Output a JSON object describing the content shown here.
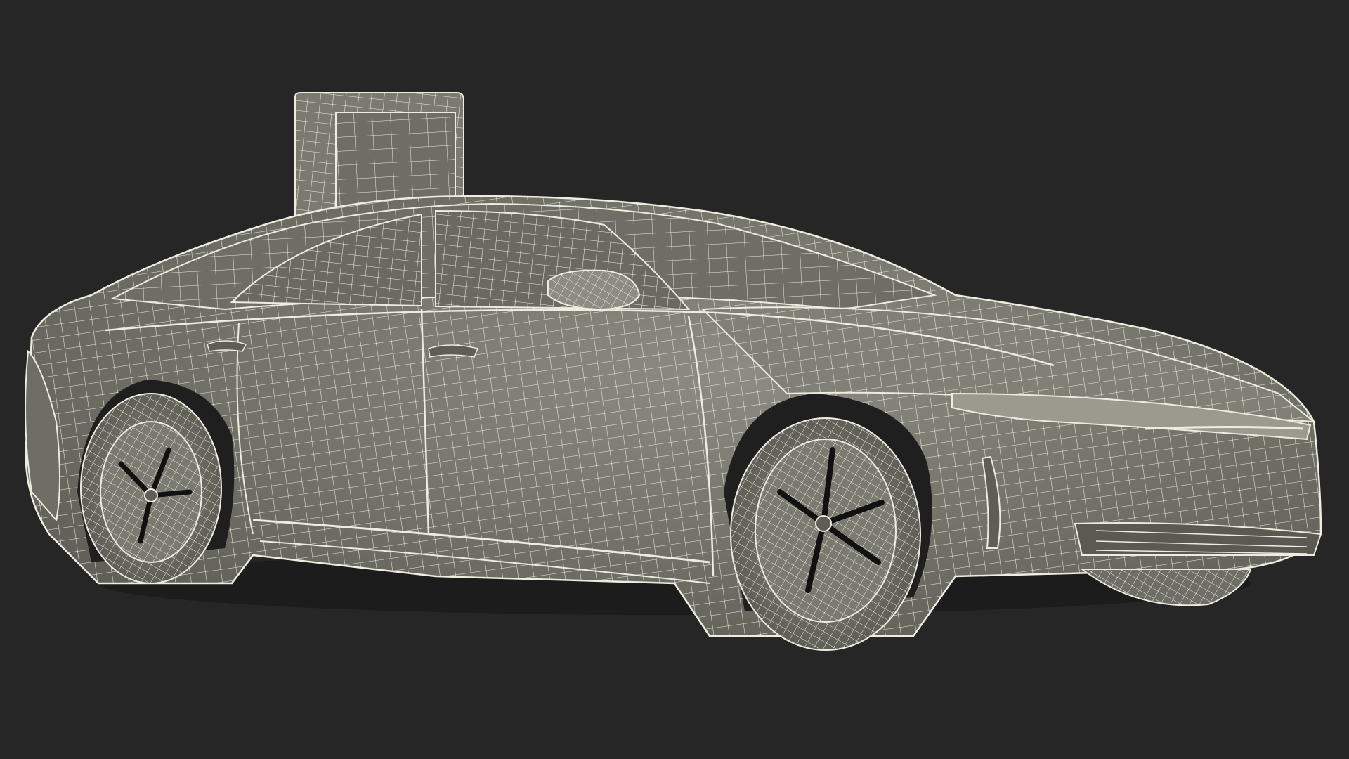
{
  "scene": {
    "subject": "wireframe-car-with-charger",
    "render_mode": "wireframe-over-clay",
    "colors": {
      "background": "#262626",
      "surface": "#7a7a70",
      "surface_light": "#8c8c82",
      "surface_dark": "#5e5e56",
      "wire": "#ecece0",
      "shadow": "#181818",
      "glass": "#6e6e66"
    },
    "icons": []
  }
}
